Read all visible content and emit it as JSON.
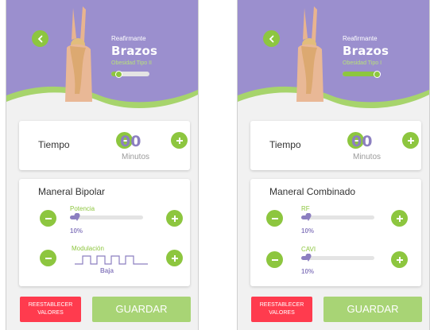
{
  "colors": {
    "accent": "#8dc63f",
    "purple": "#9b8fce",
    "value": "#8c7fc0",
    "danger": "#ff3b4e",
    "save": "#a8d475"
  },
  "screens": [
    {
      "header": {
        "subtitle": "Reafirmante",
        "title": "Brazos",
        "level": "Obesidad Tipo II",
        "progress": 0.2
      },
      "time": {
        "label": "Tiempo",
        "value": "00",
        "unit": "Minutos"
      },
      "mode": {
        "title": "Maneral Bipolar",
        "params": [
          {
            "label": "Potencia",
            "value": "10%",
            "fraction": 0.1
          },
          {
            "label": "Modulación",
            "value": "Baja"
          }
        ]
      },
      "actions": {
        "reset": "REESTABLECER VALORES",
        "save": "GUARDAR"
      }
    },
    {
      "header": {
        "subtitle": "Reafirmante",
        "title": "Brazos",
        "level": "Obesidad Tipo I",
        "progress": 0.9
      },
      "time": {
        "label": "Tiempo",
        "value": "00",
        "unit": "Minutos"
      },
      "mode": {
        "title": "Maneral Combinado",
        "params": [
          {
            "label": "RF",
            "value": "10%",
            "fraction": 0.1
          },
          {
            "label": "CAVI",
            "value": "10%",
            "fraction": 0.1
          }
        ]
      },
      "actions": {
        "reset": "REESTABLECER VALORES",
        "save": "GUARDAR"
      }
    }
  ]
}
